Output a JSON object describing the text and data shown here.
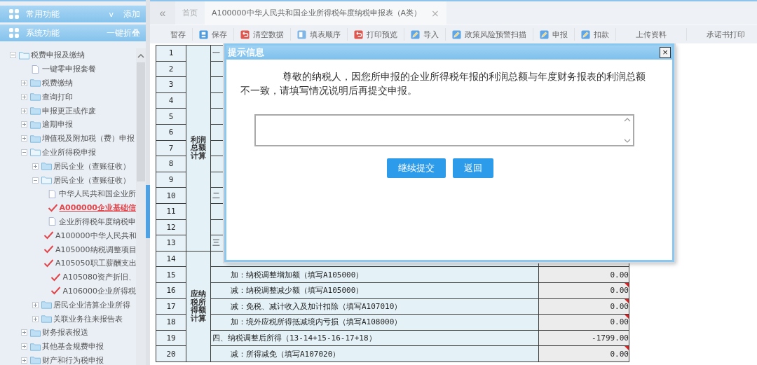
{
  "sidebar": {
    "panels": [
      {
        "title": "常用功能",
        "action": "添加",
        "caret": "v"
      },
      {
        "title": "系统功能",
        "action": "一键折叠"
      }
    ],
    "tree": [
      {
        "label": "税费申报及缴纳",
        "kind": "folder",
        "expanded": true,
        "selected": false,
        "children": [
          {
            "label": "一键零申报套餐",
            "kind": "file",
            "selected": false
          },
          {
            "label": "税费缴纳",
            "kind": "folder",
            "expanded": false,
            "selected": false
          },
          {
            "label": "查询打印",
            "kind": "folder",
            "expanded": false,
            "selected": false
          },
          {
            "label": "申报更正或作废",
            "kind": "folder",
            "expanded": false,
            "selected": false
          },
          {
            "label": "逾期申报",
            "kind": "folder",
            "expanded": false,
            "selected": false
          },
          {
            "label": "增值税及附加税（费）申报",
            "kind": "folder",
            "expanded": false,
            "selected": false
          },
          {
            "label": "企业所得税申报",
            "kind": "folder",
            "expanded": true,
            "selected": false,
            "children": [
              {
                "label": "居民企业（查账征收）",
                "kind": "folder",
                "expanded": false,
                "selected": false
              },
              {
                "label": "居民企业（查账征收）",
                "kind": "folder",
                "expanded": true,
                "selected": false,
                "children": [
                  {
                    "label": "中华人民共和国企业所",
                    "kind": "file",
                    "selected": false
                  },
                  {
                    "label": "A000000企业基础信",
                    "kind": "done",
                    "selected": true
                  },
                  {
                    "label": "企业所得税年度纳税申",
                    "kind": "file",
                    "selected": false
                  },
                  {
                    "label": "A100000中华人民共和",
                    "kind": "done",
                    "selected": false
                  },
                  {
                    "label": "A105000纳税调整项目",
                    "kind": "done",
                    "selected": false
                  },
                  {
                    "label": "A105050职工薪酬支出",
                    "kind": "done",
                    "selected": false
                  },
                  {
                    "label": "A105080资产折旧、",
                    "kind": "done",
                    "selected": false
                  },
                  {
                    "label": "A106000企业所得税",
                    "kind": "done",
                    "selected": false
                  }
                ]
              },
              {
                "label": "居民企业清算企业所得",
                "kind": "folder",
                "expanded": false,
                "selected": false
              },
              {
                "label": "关联业务往来报告表",
                "kind": "folder",
                "expanded": false,
                "selected": false
              }
            ]
          },
          {
            "label": "财务报表报送",
            "kind": "folder",
            "expanded": false,
            "selected": false
          },
          {
            "label": "其他基金规费申报",
            "kind": "folder",
            "expanded": false,
            "selected": false
          },
          {
            "label": "财产和行为税申报",
            "kind": "folder",
            "expanded": false,
            "selected": false
          }
        ]
      }
    ]
  },
  "tabs": {
    "back": "«",
    "items": [
      {
        "label": "首页",
        "selected": false
      },
      {
        "label": "A100000中华人民共和国企业所得税年度纳税申报表（A类）",
        "selected": true,
        "close": "×"
      }
    ]
  },
  "toolbar": [
    {
      "label": "暂存",
      "kind": "plain"
    },
    {
      "label": "保存",
      "kind": "save"
    },
    {
      "label": "清空数据",
      "kind": "clear"
    },
    {
      "label": "填表顺序",
      "kind": "order"
    },
    {
      "label": "打印预览",
      "kind": "clear"
    },
    {
      "label": "导入",
      "kind": "edit"
    },
    {
      "label": "政策风险预警扫描",
      "kind": "edit"
    },
    {
      "label": "申报",
      "kind": "edit"
    },
    {
      "label": "扣款",
      "kind": "edit"
    },
    {
      "label": "上传资料",
      "kind": "plain"
    },
    {
      "label": "承诺书打印",
      "kind": "plain"
    }
  ],
  "table": {
    "sections": [
      {
        "label": "利润总额计算",
        "rows": [
          {
            "no": "1",
            "item": "一",
            "kind": "main"
          },
          {
            "no": "2"
          },
          {
            "no": "3"
          },
          {
            "no": "4"
          },
          {
            "no": "5"
          },
          {
            "no": "6"
          },
          {
            "no": "7"
          },
          {
            "no": "8"
          },
          {
            "no": "9"
          },
          {
            "no": "10",
            "item": "二",
            "kind": "main"
          },
          {
            "no": "11"
          },
          {
            "no": "12"
          },
          {
            "no": "13",
            "item": "三",
            "kind": "main"
          }
        ]
      },
      {
        "label": "应纳税所得额计算",
        "rows": [
          {
            "no": "14"
          },
          {
            "no": "15",
            "item": "加：纳税调整增加额（填写A105000）",
            "kind": "sub",
            "value": "0.00"
          },
          {
            "no": "16",
            "item": "减：纳税调整减少额（填写A105000）",
            "kind": "sub",
            "value": "0.00",
            "flagged": true
          },
          {
            "no": "17",
            "item": "减：免税、减计收入及加计扣除（填写A107010）",
            "kind": "sub",
            "value": "0.00",
            "flagged": true
          },
          {
            "no": "18",
            "item": "加：境外应税所得抵减境内亏损（填写A108000）",
            "kind": "sub",
            "value": "0.00",
            "flagged": true
          },
          {
            "no": "19",
            "item": "四、纳税调整后所得（13-14+15-16-17+18）",
            "kind": "main",
            "value": "-1799.00",
            "flagged": false
          },
          {
            "no": "20",
            "item": "减：所得减免（填写A107020）",
            "kind": "sub",
            "value": "0.00",
            "flagged": true
          }
        ]
      }
    ]
  },
  "dialog": {
    "title": "提示信息",
    "close": "×",
    "message": "尊敬的纳税人，因您所申报的企业所得税年报的利润总额与年度财务报表的利润总额不一致，请填写情况说明后再提交申报。",
    "buttons": [
      "继续提交",
      "返回"
    ]
  }
}
